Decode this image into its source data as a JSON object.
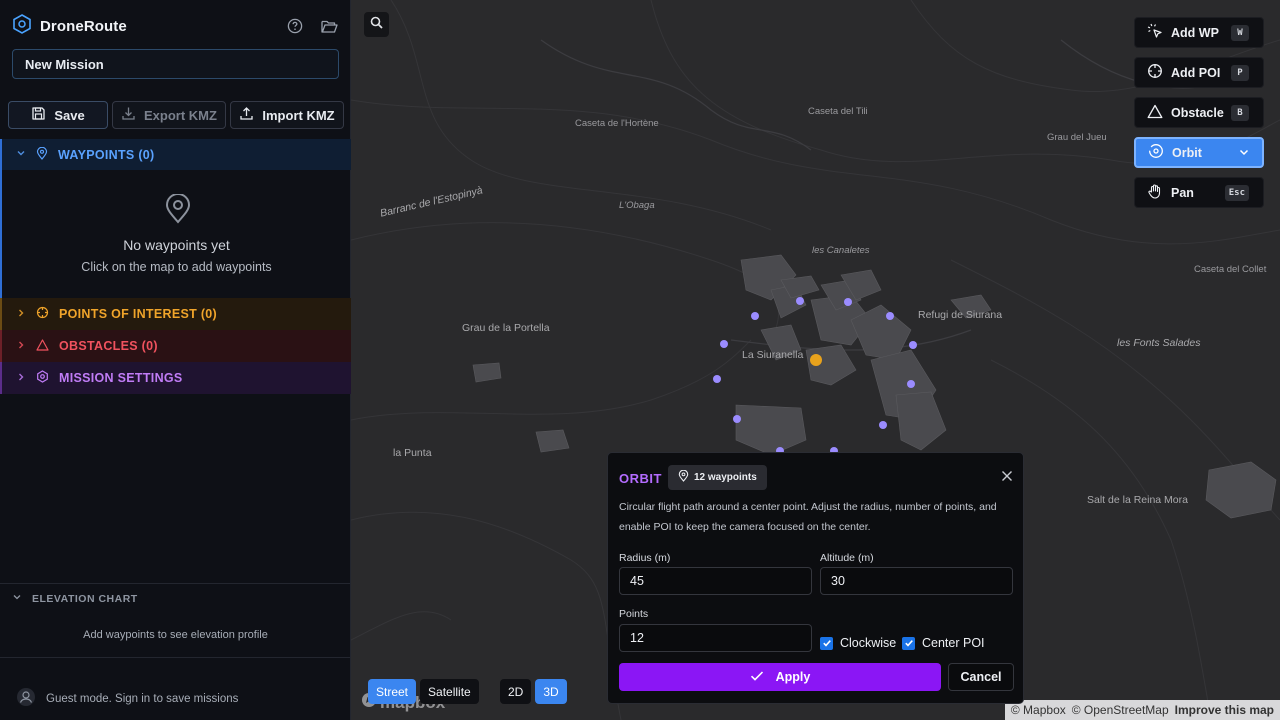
{
  "app": {
    "name": "DroneRoute"
  },
  "header": {
    "help_icon": "help-circle-icon",
    "folder_icon": "folder-open-icon"
  },
  "mission": {
    "name_value": "New Mission"
  },
  "actions": {
    "save": "Save",
    "export": "Export KMZ",
    "import": "Import KMZ"
  },
  "sections": {
    "waypoints": "WAYPOINTS (0)",
    "poi": "POINTS OF INTEREST (0)",
    "obstacles": "OBSTACLES (0)",
    "settings": "MISSION SETTINGS"
  },
  "waypoints_empty": {
    "title": "No waypoints yet",
    "hint": "Click on the map to add waypoints"
  },
  "elevation": {
    "title": "ELEVATION CHART",
    "message": "Add waypoints to see elevation profile"
  },
  "guest": "Guest mode. Sign in to save missions",
  "tools": [
    {
      "label": "Add WP",
      "key": "W"
    },
    {
      "label": "Add POI",
      "key": "P"
    },
    {
      "label": "Obstacle",
      "key": "B"
    },
    {
      "label": "Orbit",
      "key": ""
    },
    {
      "label": "Pan",
      "key": "Esc"
    }
  ],
  "map_labels": {
    "caseta_hortene": "Caseta de l'Hortène",
    "caseta_tili": "Caseta del Tili",
    "grau_jueu": "Grau del Jueu",
    "barranc": "Barranc de l'Estopinyà",
    "lobaga": "L'Obaga",
    "canaletes": "les Canaletes",
    "caseta_collet": "Caseta del Collet",
    "grau_portella": "Grau de la Portella",
    "refugi": "Refugi de Siurana",
    "fonts": "les Fonts Salades",
    "siuranella": "La Siuranella",
    "punta": "la Punta",
    "salt": "Salt de la Reina Mora"
  },
  "map_style": {
    "street": "Street",
    "satellite": "Satellite",
    "mode_2d": "2D",
    "mode_3d": "3D"
  },
  "attribution": {
    "mapbox": "© Mapbox",
    "osm": "© OpenStreetMap",
    "improve": "Improve this map",
    "logo": "mapbox"
  },
  "orbit": {
    "title": "ORBIT",
    "badge": "12 waypoints",
    "description": "Circular flight path around a center point. Adjust the radius, number of points, and enable POI to keep the camera focused on the center.",
    "radius_label": "Radius (m)",
    "radius_value": "45",
    "altitude_label": "Altitude (m)",
    "altitude_value": "30",
    "points_label": "Points",
    "points_value": "12",
    "clockwise_label": "Clockwise",
    "clockwise_checked": true,
    "center_poi_label": "Center POI",
    "center_poi_checked": true,
    "apply": "Apply",
    "cancel": "Cancel"
  },
  "colors": {
    "accent_blue": "#3b86f0",
    "orbit_purple": "#8b16f5",
    "poi_orange": "#f0a42a",
    "obstacle_red": "#f0525e",
    "waypoint_dot": "#9b8cff"
  }
}
